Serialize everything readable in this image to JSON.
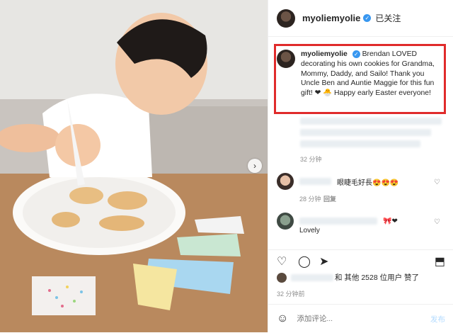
{
  "post": {
    "username": "myoliemyolie",
    "follow_status": "已关注",
    "caption_username": "myoliemyolie",
    "caption_text": "Brendan LOVED decorating his own cookies for Grandma, Mommy, Daddy, and Sailo! Thank you Uncle Ben and Auntie Maggie for this fun gift! ❤ 🐣 Happy early Easter everyone!",
    "caption_time": "32 分钟"
  },
  "comments": [
    {
      "text": "眼睫毛好長😍😍😍",
      "time": "28 分钟",
      "reply": "回复"
    },
    {
      "text": "Lovely",
      "emoji": "🎀❤"
    }
  ],
  "likes": {
    "text": "和 其他 2528 位用户 赞了"
  },
  "posted_time": "32 分钟前",
  "add_comment": {
    "placeholder": "添加评论...",
    "post_label": "发布"
  },
  "icons": {
    "like": "heart-icon",
    "comment": "comment-icon",
    "share": "share-icon",
    "save": "bookmark-icon",
    "emoji": "emoji-icon",
    "next": "chevron-right-icon"
  },
  "colors": {
    "highlight_box": "#e02b2b",
    "verified": "#3897f0",
    "post_disabled": "#b3dbff"
  }
}
